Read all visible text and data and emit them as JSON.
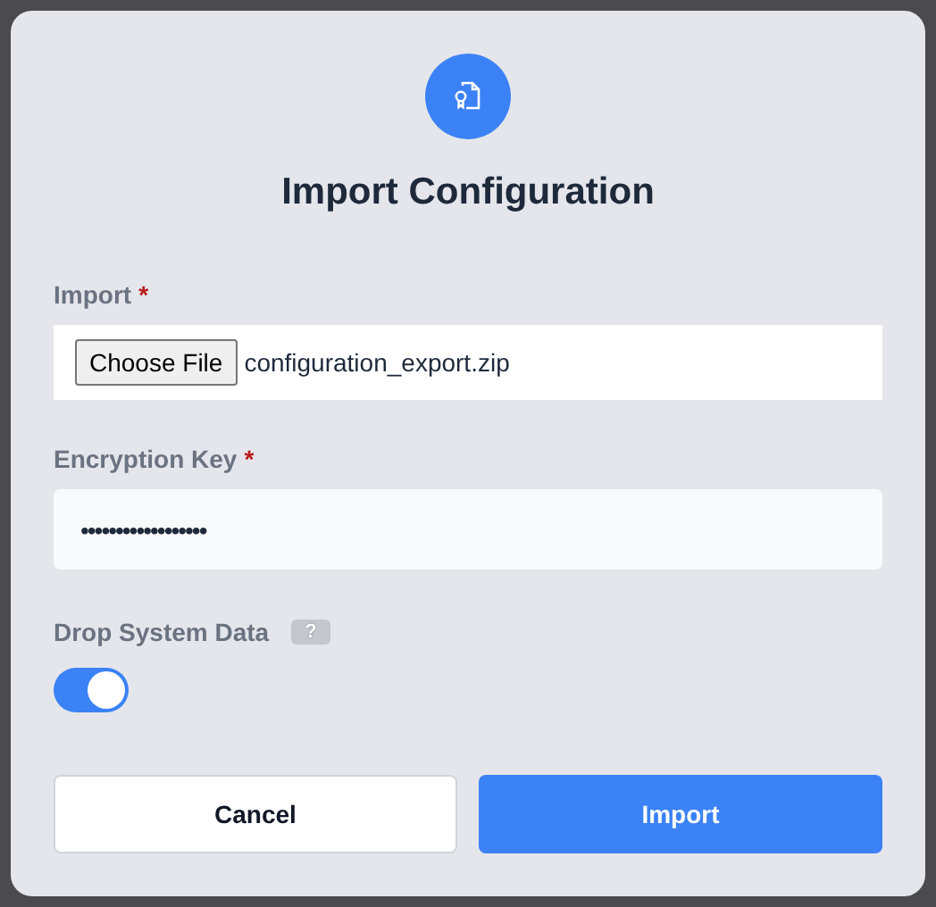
{
  "dialog": {
    "title": "Import Configuration",
    "file_field": {
      "label": "Import",
      "required_mark": "*",
      "button": "Choose File",
      "file_name": "configuration_export.zip"
    },
    "key_field": {
      "label": "Encryption Key",
      "required_mark": "*",
      "value": "••••••••••••••••••"
    },
    "toggle": {
      "label": "Drop System Data",
      "help": "?",
      "on": true
    },
    "buttons": [
      {
        "label": "Cancel",
        "kind": "secondary"
      },
      {
        "label": "Import",
        "kind": "primary"
      }
    ]
  }
}
